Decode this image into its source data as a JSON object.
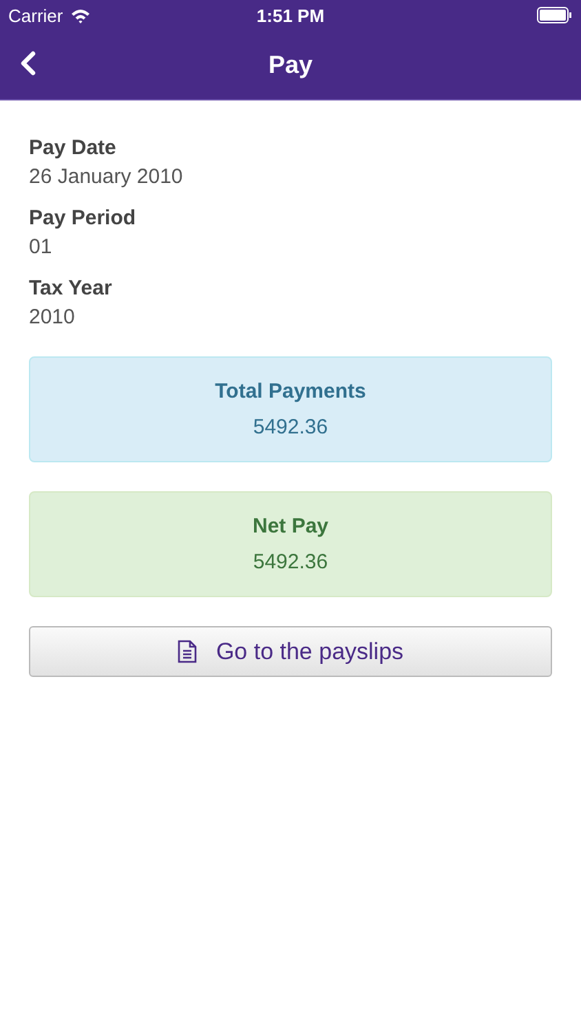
{
  "status_bar": {
    "carrier": "Carrier",
    "time": "1:51 PM"
  },
  "nav": {
    "title": "Pay"
  },
  "fields": [
    {
      "label": "Pay Date",
      "value": "26 January 2010"
    },
    {
      "label": "Pay Period",
      "value": "01"
    },
    {
      "label": "Tax Year",
      "value": "2010"
    }
  ],
  "panels": [
    {
      "kind": "info",
      "title": "Total Payments",
      "value": "5492.36"
    },
    {
      "kind": "success",
      "title": "Net Pay",
      "value": "5492.36"
    }
  ],
  "button": {
    "label": "Go to the payslips"
  }
}
